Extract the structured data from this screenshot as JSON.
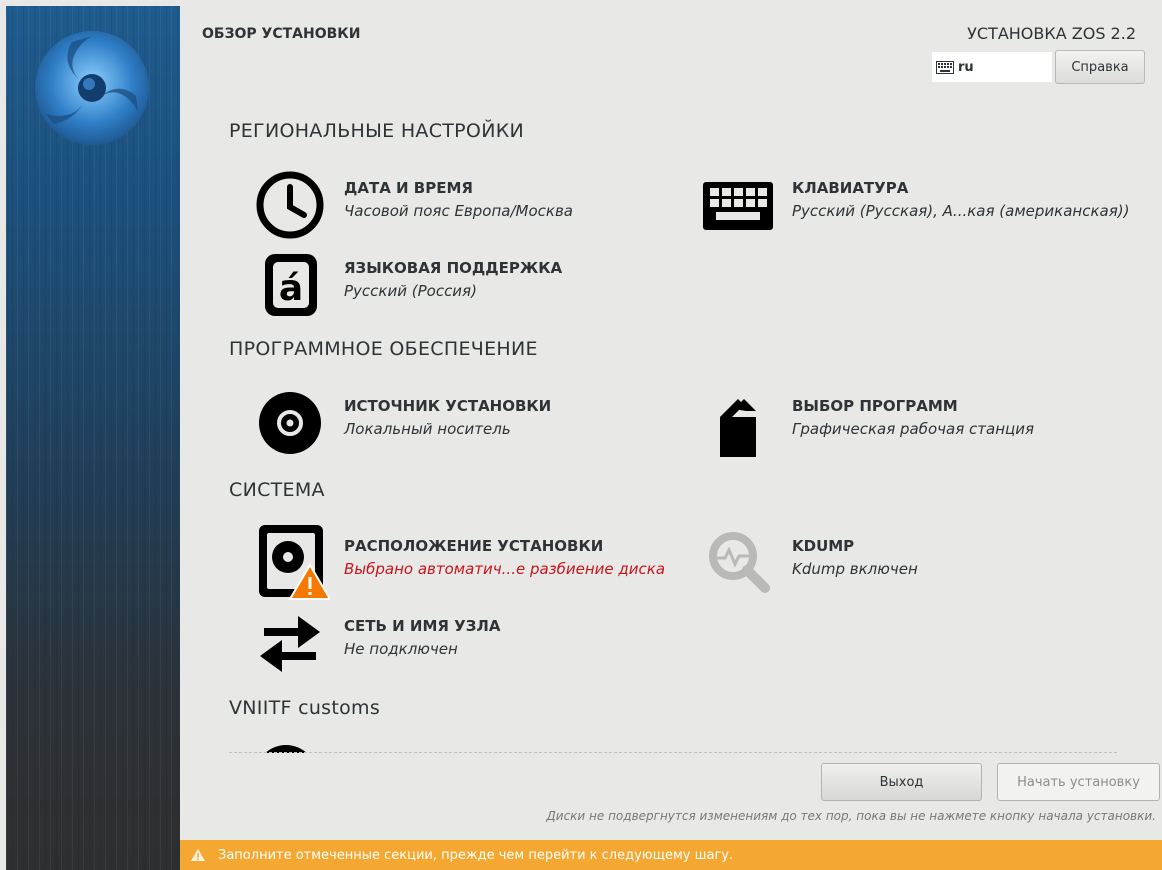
{
  "header": {
    "title": "ОБЗОР УСТАНОВКИ",
    "product": "УСТАНОВКА ZOS 2.2",
    "keyboard_layout": "ru",
    "help_button": "Справка"
  },
  "sections": [
    {
      "title": "РЕГИОНАЛЬНЫЕ НАСТРОЙКИ",
      "spokes": [
        {
          "name": "ДАТА И ВРЕМЯ",
          "status": "Часовой пояс Европа/Москва",
          "icon": "clock-icon"
        },
        {
          "name": "КЛАВИАТУРА",
          "status": "Русский (Русская), А...кая (американская))",
          "icon": "keyboard-icon"
        },
        {
          "name": "ЯЗЫКОВАЯ ПОДДЕРЖКА",
          "status": "Русский (Россия)",
          "icon": "language-icon"
        }
      ]
    },
    {
      "title": "ПРОГРАММНОЕ ОБЕСПЕЧЕНИЕ",
      "spokes": [
        {
          "name": "ИСТОЧНИК УСТАНОВКИ",
          "status": "Локальный носитель",
          "icon": "disc-icon"
        },
        {
          "name": "ВЫБОР ПРОГРАММ",
          "status": "Графическая рабочая станция",
          "icon": "package-icon"
        }
      ]
    },
    {
      "title": "СИСТЕМА",
      "spokes": [
        {
          "name": "РАСПОЛОЖЕНИЕ УСТАНОВКИ",
          "status": "Выбрано автоматич...е разбиение диска",
          "icon": "harddisk-warning-icon",
          "warning": true
        },
        {
          "name": "KDUMP",
          "status": "Kdump включен",
          "icon": "kdump-magnifier-icon"
        },
        {
          "name": "СЕТЬ И ИМЯ УЗЛА",
          "status": "Не подключен",
          "icon": "network-arrows-icon"
        }
      ]
    },
    {
      "title": "VNIITF customs",
      "spokes": []
    }
  ],
  "footer": {
    "exit_button": "Выход",
    "start_button": "Начать установку",
    "note": "Диски не подвергнутся изменениям до тех пор, пока вы не нажмете кнопку начала установки.",
    "warning_message": "Заполните отмеченные секции, прежде чем перейти к следующему шагу."
  },
  "colors": {
    "warning_bar": "#f5a831",
    "warning_text": "#c4161c",
    "sidebar_top": "#1f5b8e",
    "sidebar_bottom": "#2e2f30"
  }
}
